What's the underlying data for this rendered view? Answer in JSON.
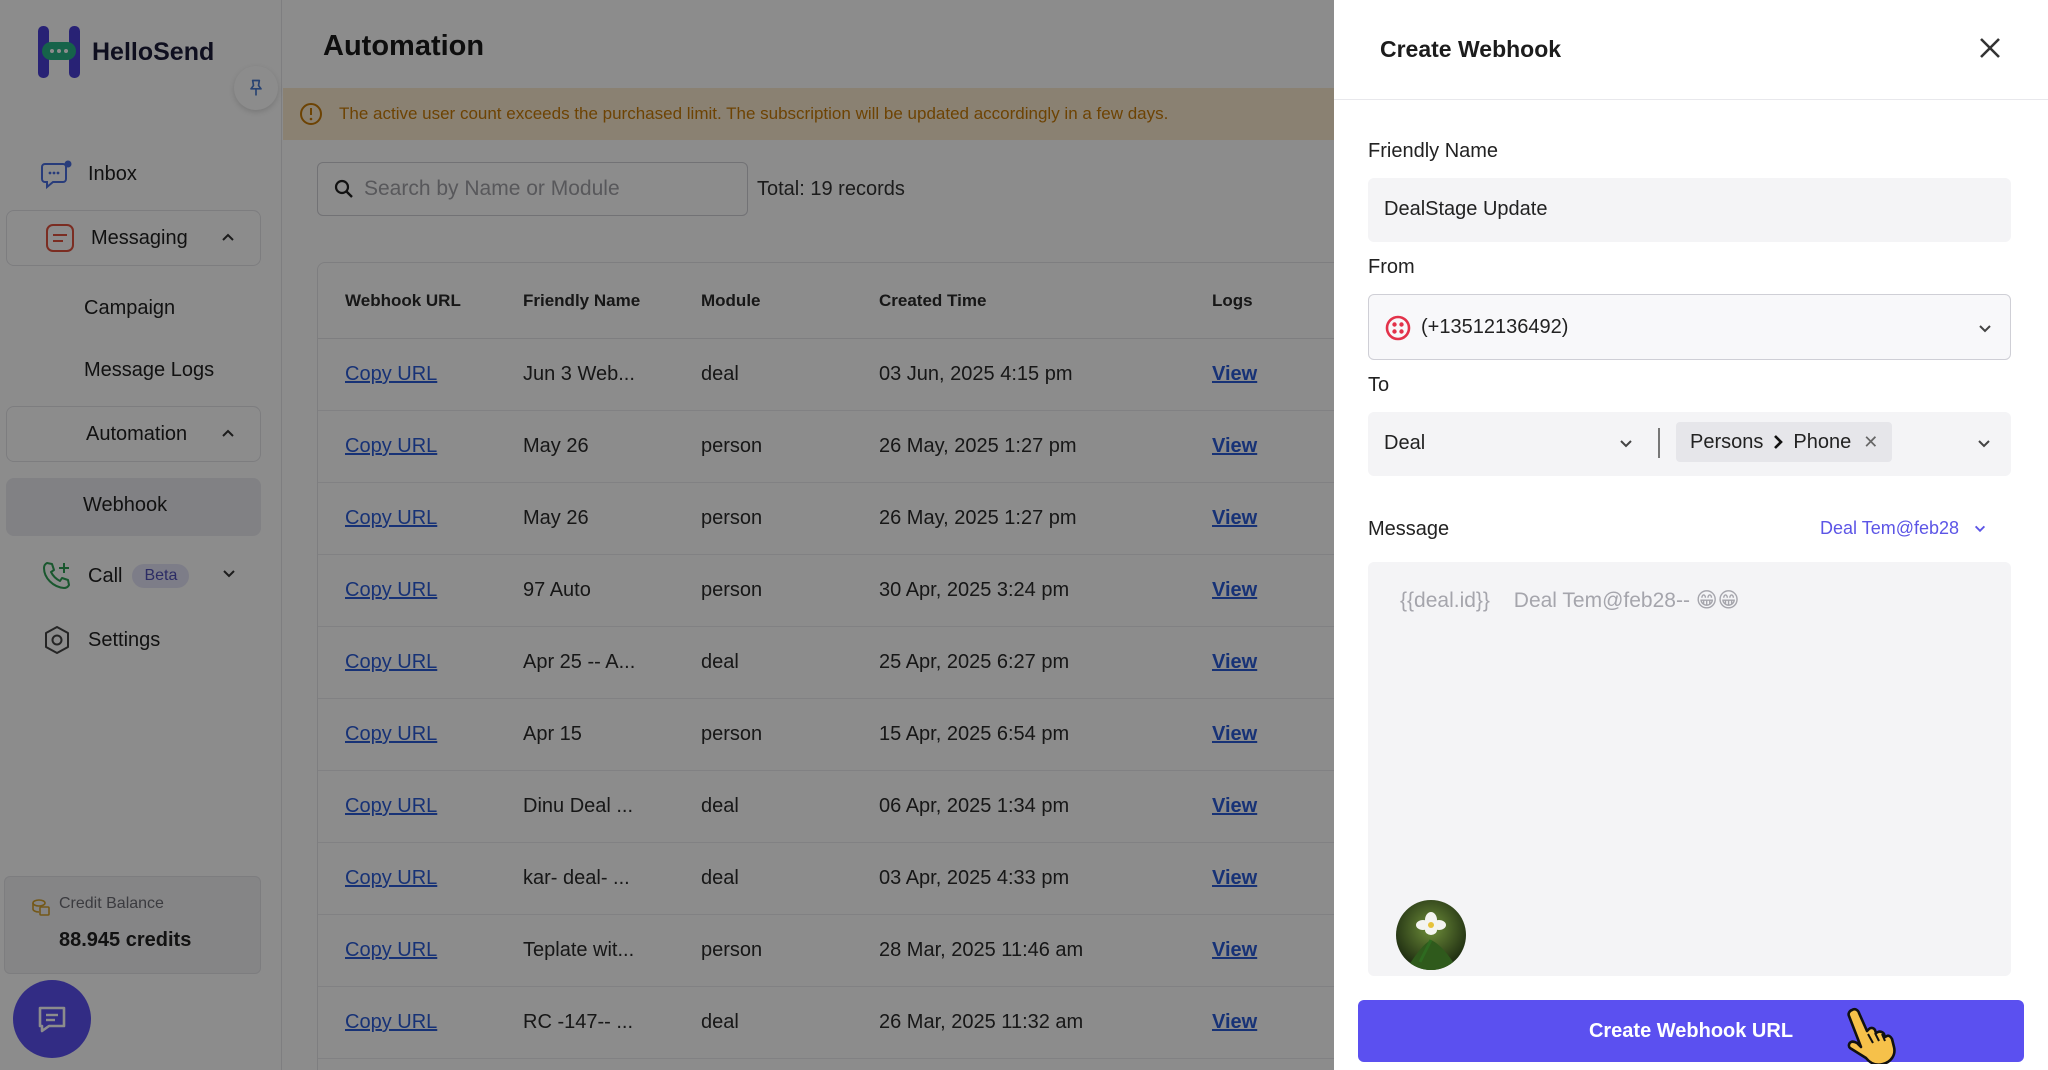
{
  "sidebar": {
    "app_name": "HelloSend",
    "nav": {
      "inbox": "Inbox",
      "messaging": "Messaging",
      "campaign": "Campaign",
      "message_logs": "Message Logs",
      "automation": "Automation",
      "webhook": "Webhook",
      "call": "Call",
      "call_badge": "Beta",
      "settings": "Settings"
    },
    "credit": {
      "label": "Credit Balance",
      "value": "88.945 credits"
    }
  },
  "main": {
    "title": "Automation",
    "banner": "The active user count exceeds the purchased limit. The subscription will be updated accordingly in a few days.",
    "search_placeholder": "Search by Name or Module",
    "total": "Total: 19 records",
    "columns": [
      "Webhook URL",
      "Friendly Name",
      "Module",
      "Created Time",
      "Logs"
    ],
    "rows": [
      {
        "url": "Copy URL",
        "name": "Jun 3 Web...",
        "module": "deal",
        "created": "03 Jun, 2025 4:15 pm",
        "logs": "View"
      },
      {
        "url": "Copy URL",
        "name": "May 26",
        "module": "person",
        "created": "26 May, 2025 1:27 pm",
        "logs": "View"
      },
      {
        "url": "Copy URL",
        "name": "May 26",
        "module": "person",
        "created": "26 May, 2025 1:27 pm",
        "logs": "View"
      },
      {
        "url": "Copy URL",
        "name": "97 Auto",
        "module": "person",
        "created": "30 Apr, 2025 3:24 pm",
        "logs": "View"
      },
      {
        "url": "Copy URL",
        "name": "Apr 25 -- A...",
        "module": "deal",
        "created": "25 Apr, 2025 6:27 pm",
        "logs": "View"
      },
      {
        "url": "Copy URL",
        "name": "Apr 15",
        "module": "person",
        "created": "15 Apr, 2025 6:54 pm",
        "logs": "View"
      },
      {
        "url": "Copy URL",
        "name": "Dinu Deal ...",
        "module": "deal",
        "created": "06 Apr, 2025 1:34 pm",
        "logs": "View"
      },
      {
        "url": "Copy URL",
        "name": "kar- deal- ...",
        "module": "deal",
        "created": "03 Apr, 2025 4:33 pm",
        "logs": "View"
      },
      {
        "url": "Copy URL",
        "name": "Teplate wit...",
        "module": "person",
        "created": "28 Mar, 2025 11:46 am",
        "logs": "View"
      },
      {
        "url": "Copy URL",
        "name": "RC -147-- ...",
        "module": "deal",
        "created": "26 Mar, 2025 11:32 am",
        "logs": "View"
      }
    ]
  },
  "panel": {
    "title": "Create Webhook",
    "friendly_name_label": "Friendly Name",
    "friendly_name_value": "DealStage Update",
    "from_label": "From",
    "from_value": "(+13512136492)",
    "to_label": "To",
    "to_module": "Deal",
    "to_chip_part1": "Persons",
    "to_chip_part2": "Phone",
    "message_label": "Message",
    "template_name": "Deal Tem@feb28",
    "message_token": "{{deal.id}}",
    "message_body": "Deal Tem@feb28-- 😁😁",
    "submit_label": "Create Webhook URL"
  },
  "colors": {
    "primary": "#5b50f0",
    "link": "#2a5bd7",
    "banner_bg": "#fcebd0",
    "banner_text": "#c77a07",
    "messaging_icon": "#e0533e",
    "call_icon": "#2e9e55"
  }
}
